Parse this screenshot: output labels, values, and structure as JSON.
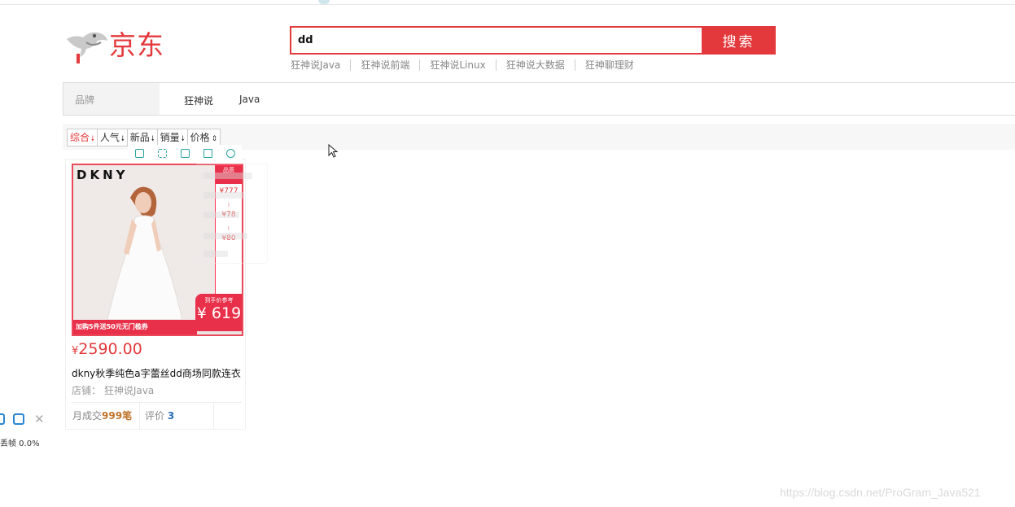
{
  "logo": {
    "text": "京东"
  },
  "search": {
    "value": "dd",
    "button_label": "搜索",
    "hotwords": [
      "狂神说Java",
      "狂神说前端",
      "狂神说Linux",
      "狂神说大数据",
      "狂神聊理财"
    ]
  },
  "brand_filter": {
    "key": "品牌",
    "values": [
      "狂神说",
      "Java"
    ]
  },
  "sort": {
    "items": [
      {
        "label": "综合",
        "arrow": "🠗"
      },
      {
        "label": "人气",
        "arrow": "🠗"
      },
      {
        "label": "新品",
        "arrow": "🠗"
      },
      {
        "label": "销量",
        "arrow": "🠗"
      },
      {
        "label": "价格",
        "arrow": "⇕"
      }
    ]
  },
  "toolbar_icons": [
    "copy-icon",
    "expand-icon",
    "save-icon",
    "share-icon",
    "settings-icon"
  ],
  "product": {
    "brand_mark": "DKNY",
    "side": {
      "top": "品质",
      "prices": [
        "¥777",
        "¥78",
        "¥80"
      ]
    },
    "final_label": "到手价参考",
    "final_price": "¥ 619",
    "promo": "加购5件送50元无门槛券",
    "price_currency": "¥",
    "price": "2590.00",
    "title": "dkny秋季纯色a字蕾丝dd商场同款连衣",
    "shop_label": "店铺：",
    "shop_name": "狂神说Java",
    "sold_label": "月成交",
    "sold_count": "999笔",
    "review_label": "评价",
    "review_count": "3"
  },
  "float_widget": {
    "status": "丢帧 0.0%"
  },
  "watermark": "https://blog.csdn.net/ProGram_Java521",
  "colors": {
    "accent": "#e4393c",
    "teal": "#2aa5a0"
  }
}
